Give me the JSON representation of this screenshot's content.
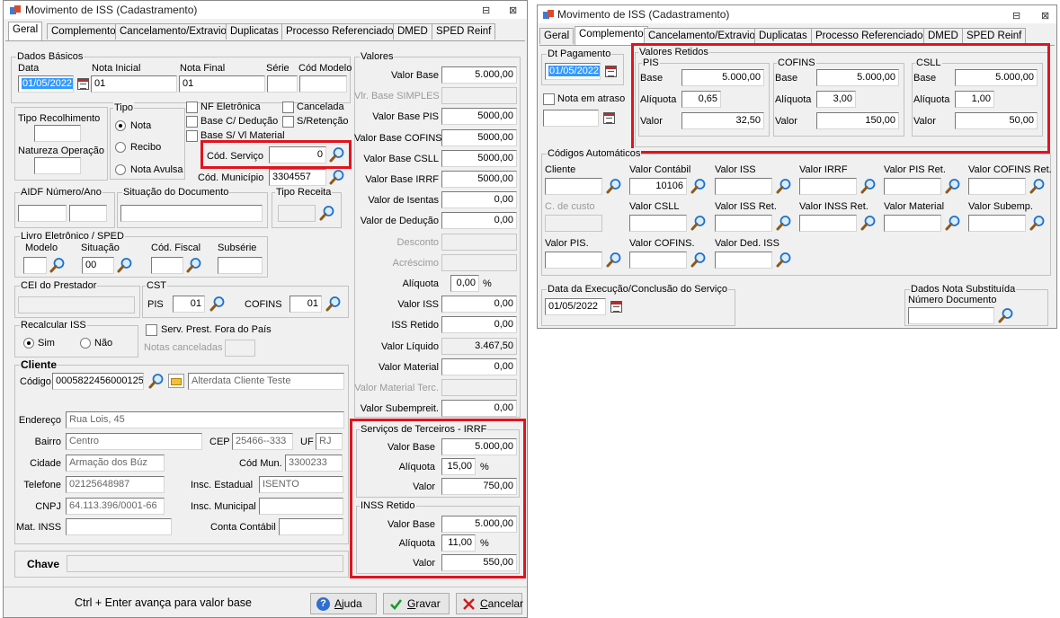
{
  "left": {
    "title": "Movimento de ISS (Cadastramento)",
    "window_controls": {
      "minimize": "⊟",
      "close": "⊠"
    },
    "tabs": [
      "Geral",
      "Complemento",
      "Cancelamento/Extravio",
      "Duplicatas",
      "Processo Referenciado",
      "DMED",
      "SPED Reinf"
    ],
    "dados_basicos": {
      "group": "Dados Básicos",
      "data_label": "Data",
      "data": "01/05/2022",
      "nota_inicial_label": "Nota Inicial",
      "nota_inicial": "01",
      "nota_final_label": "Nota Final",
      "nota_final": "01",
      "serie_label": "Série",
      "serie": "",
      "cod_modelo_label": "Cód Modelo",
      "cod_modelo": ""
    },
    "tipo_recolhimento": "Tipo Recolhimento",
    "natureza_operacao": "Natureza Operação",
    "tipo": {
      "group": "Tipo",
      "options": [
        "Nota",
        "Recibo",
        "Nota Avulsa"
      ]
    },
    "checks": {
      "nf_eletronica": "NF Eletrônica",
      "cancelada": "Cancelada",
      "base_deducao": "Base C/ Dedução",
      "retencao": "S/Retenção",
      "base_vl_material": "Base S/ Vl Material"
    },
    "cod_servico": {
      "label": "Cód. Serviço",
      "value": "0"
    },
    "cod_municipio": {
      "label": "Cód. Município",
      "value": "3304557"
    },
    "aidf": "AIDF Número/Ano",
    "situacao_documento": "Situação do Documento",
    "tipo_receita": "Tipo Receita",
    "livro": {
      "group": "Livro Eletrônico / SPED",
      "modelo": "Modelo",
      "situacao": "Situação",
      "situacao_value": "00",
      "cod_fiscal": "Cód. Fiscal",
      "subserie": "Subsérie"
    },
    "cei": "CEI do Prestador",
    "cst": {
      "group": "CST",
      "pis": "PIS",
      "pis_value": "01",
      "cofins": "COFINS",
      "cofins_value": "01"
    },
    "recalcular": {
      "group": "Recalcular ISS",
      "sim": "Sim",
      "nao": "Não"
    },
    "serv_prest": "Serv. Prest. Fora do País",
    "notas_canceladas": "Notas canceladas",
    "cliente": {
      "group": "Cliente",
      "codigo_label": "Código",
      "codigo": "0005822456000125",
      "nome": "Alterdata Cliente Teste",
      "endereco_label": "Endereço",
      "endereco": "Rua Lois, 45",
      "bairro_label": "Bairro",
      "bairro": "Centro",
      "cep_label": "CEP",
      "cep": "25466--333",
      "uf_label": "UF",
      "uf": "RJ",
      "cidade_label": "Cidade",
      "cidade": "Armação dos Búz",
      "cod_mun_label": "Cód Mun.",
      "cod_mun": "3300233",
      "telefone_label": "Telefone",
      "telefone": "02125648987",
      "insc_estadual_label": "Insc. Estadual",
      "insc_estadual": "ISENTO",
      "cnpj_label": "CNPJ",
      "cnpj": "64.113.396/0001-66",
      "insc_municipal_label": "Insc. Municipal",
      "mat_inss_label": "Mat. INSS",
      "conta_contabil_label": "Conta Contábil"
    },
    "chave": "Chave",
    "valores": {
      "group": "Valores",
      "rows": [
        {
          "label": "Valor Base",
          "value": "5.000,00"
        },
        {
          "label": "Vlr. Base SIMPLES",
          "value": ""
        },
        {
          "label": "Valor Base PIS",
          "value": "5000,00"
        },
        {
          "label": "Valor Base COFINS",
          "value": "5000,00"
        },
        {
          "label": "Valor Base CSLL",
          "value": "5000,00"
        },
        {
          "label": "Valor Base IRRF",
          "value": "5000,00"
        },
        {
          "label": "Valor de Isentas",
          "value": "0,00"
        },
        {
          "label": "Valor de Dedução",
          "value": "0,00"
        },
        {
          "label": "Desconto",
          "value": ""
        },
        {
          "label": "Acréscimo",
          "value": ""
        },
        {
          "label": "Alíquota",
          "value": "0,00",
          "suffix": "%"
        },
        {
          "label": "Valor ISS",
          "value": "0,00"
        },
        {
          "label": "ISS Retido",
          "value": "0,00"
        },
        {
          "label": "Valor Líquido",
          "value": "3.467,50"
        },
        {
          "label": "Valor Material",
          "value": "0,00"
        },
        {
          "label": "Valor Material Terc.",
          "value": ""
        },
        {
          "label": "Valor Subempreit.",
          "value": "0,00"
        }
      ]
    },
    "irrf": {
      "group": "Serviços de Terceiros - IRRF",
      "base_label": "Valor Base",
      "base": "5.000,00",
      "aliquota_label": "Alíquota",
      "aliquota": "15,00",
      "pct": "%",
      "valor_label": "Valor",
      "valor": "750,00"
    },
    "inss": {
      "group": "INSS Retido",
      "base_label": "Valor Base",
      "base": "5.000,00",
      "aliquota_label": "Alíquota",
      "aliquota": "11,00",
      "pct": "%",
      "valor_label": "Valor",
      "valor": "550,00"
    },
    "footer": {
      "hint": "Ctrl + Enter avança para valor base",
      "ajuda_pre": "",
      "ajuda_u": "A",
      "ajuda_post": "juda",
      "gravar_pre": "",
      "gravar_u": "G",
      "gravar_post": "ravar",
      "cancelar_pre": "",
      "cancelar_u": "C",
      "cancelar_post": "ancelar"
    }
  },
  "right": {
    "title": "Movimento de ISS (Cadastramento)",
    "window_controls": {
      "minimize": "⊟",
      "close": "⊠"
    },
    "tabs": [
      "Geral",
      "Complemento",
      "Cancelamento/Extravio",
      "Duplicatas",
      "Processo Referenciado",
      "DMED",
      "SPED Reinf"
    ],
    "dt_pagamento": {
      "group": "Dt Pagamento",
      "value": "01/05/2022"
    },
    "nota_atraso": "Nota em atraso",
    "valores_retidos": {
      "group": "Valores Retidos",
      "pis": {
        "group": "PIS",
        "base_label": "Base",
        "base": "5.000,00",
        "aliquota_label": "Alíquota",
        "aliquota": "0,65",
        "valor_label": "Valor",
        "valor": "32,50"
      },
      "cofins": {
        "group": "COFINS",
        "base_label": "Base",
        "base": "5.000,00",
        "aliquota_label": "Alíquota",
        "aliquota": "3,00",
        "valor_label": "Valor",
        "valor": "150,00"
      },
      "csll": {
        "group": "CSLL",
        "base_label": "Base",
        "base": "5.000,00",
        "aliquota_label": "Alíquota",
        "aliquota": "1,00",
        "valor_label": "Valor",
        "valor": "50,00"
      }
    },
    "codigos": {
      "group": "Códigos Automáticos",
      "cliente": "Cliente",
      "valor_contabil": "Valor Contábil",
      "valor_contabil_value": "10106",
      "valor_iss": "Valor ISS",
      "valor_irrf": "Valor IRRF",
      "valor_pis_ret": "Valor PIS Ret.",
      "valor_cofins_ret": "Valor COFINS Ret.",
      "c_custo": "C. de custo",
      "valor_csll": "Valor CSLL",
      "valor_iss_ret": "Valor ISS Ret.",
      "valor_inss_ret": "Valor INSS Ret.",
      "valor_material": "Valor Material",
      "valor_subemp": "Valor Subemp.",
      "valor_pis": "Valor PIS.",
      "valor_cofins": "Valor COFINS.",
      "valor_ded_iss": "Valor Ded. ISS"
    },
    "data_execucao": {
      "group": "Data da Execução/Conclusão do Serviço",
      "value": "01/05/2022"
    },
    "dados_nota": {
      "group": "Dados Nota Substituída",
      "numero_label": "Número Documento"
    }
  }
}
